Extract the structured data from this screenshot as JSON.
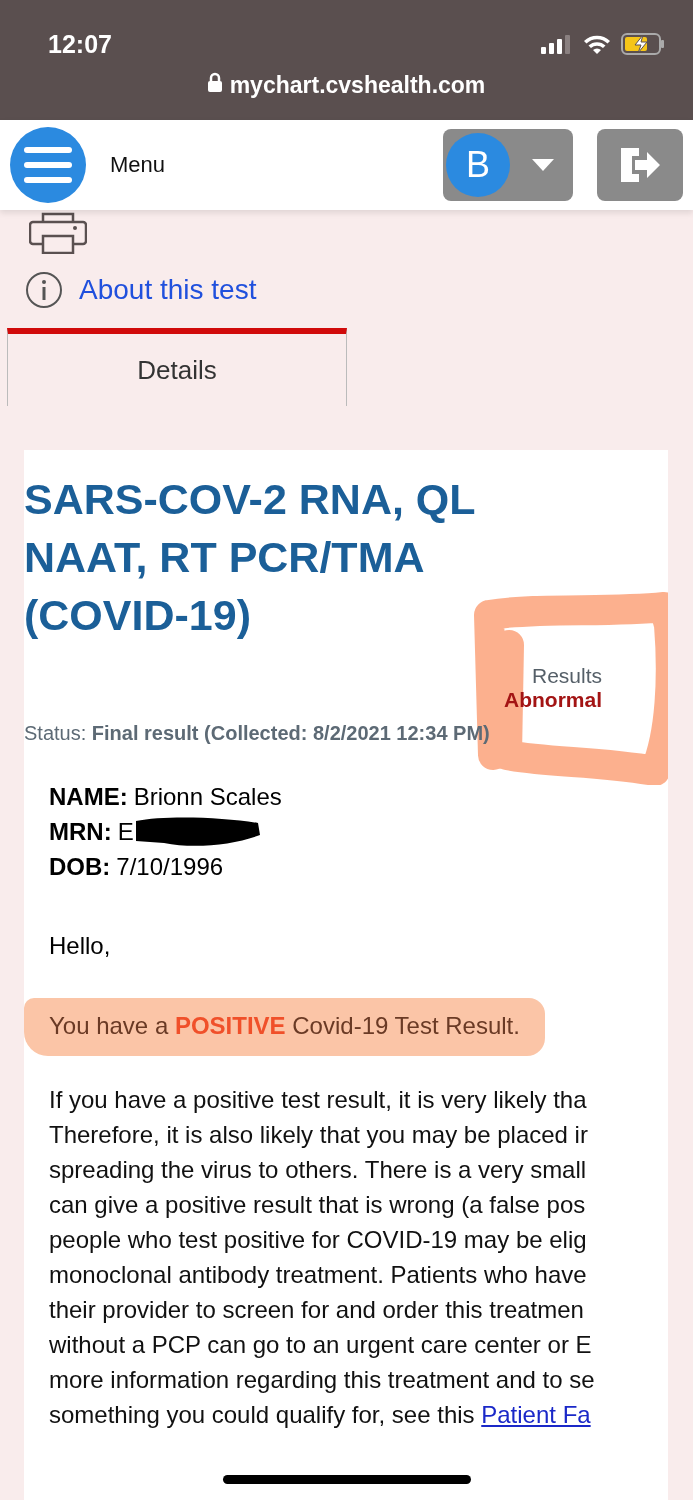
{
  "status_bar": {
    "time": "12:07",
    "url": "mychart.cvshealth.com"
  },
  "header": {
    "menu_label": "Menu",
    "avatar_letter": "B"
  },
  "about_link": "About this test",
  "tabs": [
    {
      "label": "Details",
      "selected": true
    }
  ],
  "result": {
    "title": "SARS-COV-2 RNA, QL NAAT, RT PCR/TMA (COVID-19)",
    "results_label": "Results",
    "results_value": "Abnormal",
    "status": "Status: **Final result  (Collected: 8/2/2021 12:34 PM)**",
    "fields": [
      {
        "label": "NAME:",
        "value": "Brionn Scales",
        "redacted": false
      },
      {
        "label": "MRN:",
        "value": "E",
        "redacted": true
      },
      {
        "label": "DOB:",
        "value": "7/10/1996",
        "redacted": false
      }
    ],
    "greeting": "Hello,",
    "message": "You have a **POSITIVE** Covid-19 Test Result.",
    "paragraph_lines": [
      "If you have a positive test result, it is very likely tha",
      "Therefore, it is also likely that you may be placed ir",
      "spreading the virus to others. There is a very small",
      "can give a positive result that is wrong (a false pos",
      "people who test positive for COVID-19 may be elig",
      "monoclonal antibody treatment. Patients who have",
      "their provider to screen for and order this treatmen",
      "without a PCP can go to an urgent care center or E",
      "more information regarding this treatment and to se",
      "something you could qualify for, see this "
    ],
    "link": "Patient Fa"
  }
}
